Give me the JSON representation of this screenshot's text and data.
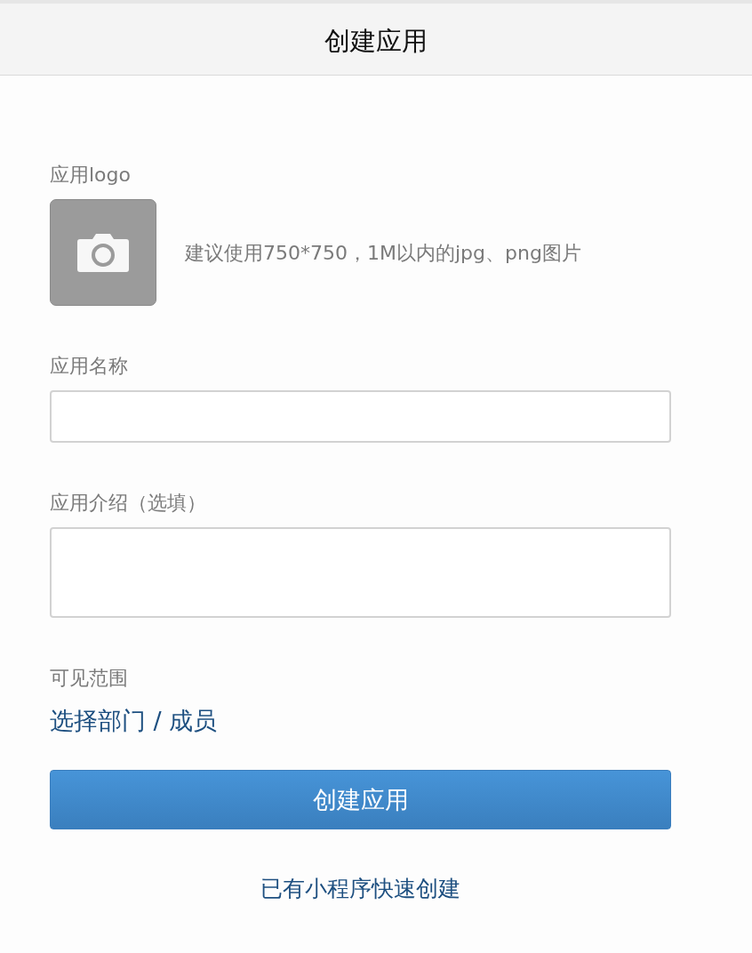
{
  "header": {
    "title": "创建应用"
  },
  "form": {
    "logo": {
      "label": "应用logo",
      "hint": "建议使用750*750，1M以内的jpg、png图片"
    },
    "fields": [
      {
        "kind": "input",
        "label": "应用名称"
      },
      {
        "kind": "textarea",
        "label": "应用介绍（选填）"
      }
    ],
    "visibility": {
      "label": "可见范围",
      "link": "选择部门 / 成员"
    },
    "submit_button": "创建应用",
    "secondary_link": "已有小程序快速创建"
  }
}
